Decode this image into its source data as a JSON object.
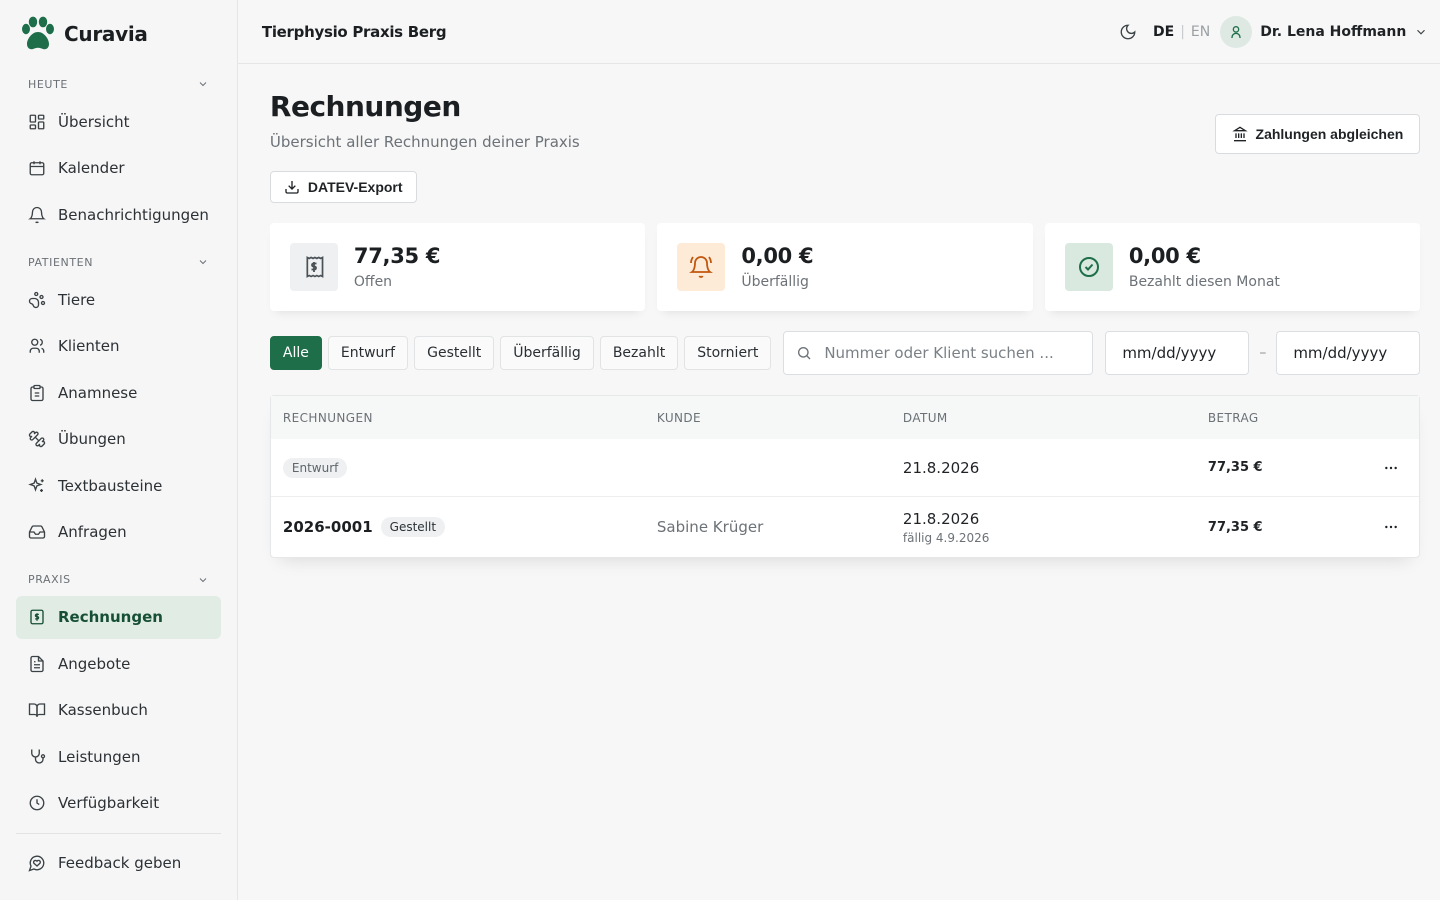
{
  "brand": {
    "name": "Curavia"
  },
  "sidebar": {
    "sections": [
      {
        "title": "HEUTE",
        "items": [
          {
            "label": "Übersicht",
            "icon": "layout-dashboard-icon"
          },
          {
            "label": "Kalender",
            "icon": "calendar-icon"
          },
          {
            "label": "Benachrichtigungen",
            "icon": "bell-icon"
          }
        ]
      },
      {
        "title": "PATIENTEN",
        "items": [
          {
            "label": "Tiere",
            "icon": "paw-icon"
          },
          {
            "label": "Klienten",
            "icon": "users-icon"
          },
          {
            "label": "Anamnese",
            "icon": "clipboard-icon"
          },
          {
            "label": "Übungen",
            "icon": "dumbbell-icon"
          },
          {
            "label": "Textbausteine",
            "icon": "sparkles-icon"
          },
          {
            "label": "Anfragen",
            "icon": "inbox-icon"
          }
        ]
      },
      {
        "title": "PRAXIS",
        "items": [
          {
            "label": "Rechnungen",
            "icon": "receipt-icon",
            "active": true
          },
          {
            "label": "Angebote",
            "icon": "file-text-icon"
          },
          {
            "label": "Kassenbuch",
            "icon": "book-open-icon"
          },
          {
            "label": "Leistungen",
            "icon": "stethoscope-icon"
          },
          {
            "label": "Verfügbarkeit",
            "icon": "clock-icon"
          }
        ]
      }
    ],
    "feedback": "Feedback geben"
  },
  "header": {
    "practice": "Tierphysio Praxis Berg",
    "lang_active": "DE",
    "lang_inactive": "EN",
    "user": "Dr. Lena Hoffmann"
  },
  "page": {
    "title": "Rechnungen",
    "subtitle": "Übersicht aller Rechnungen deiner Praxis",
    "sync_button": "Zahlungen abgleichen",
    "export_button": "DATEV-Export"
  },
  "stats": [
    {
      "value": "77,35 €",
      "label": "Offen",
      "icon": "receipt-icon",
      "bg": "#eef0f2",
      "fg": "#4b5257"
    },
    {
      "value": "0,00 €",
      "label": "Überfällig",
      "icon": "bell-ring-icon",
      "bg": "#fdebd8",
      "fg": "#c2570e"
    },
    {
      "value": "0,00 €",
      "label": "Bezahlt diesen Monat",
      "icon": "check-circle-icon",
      "bg": "#d9e9df",
      "fg": "#1e6f49"
    }
  ],
  "filters": {
    "chips": [
      "Alle",
      "Entwurf",
      "Gestellt",
      "Überfällig",
      "Bezahlt",
      "Storniert"
    ],
    "active": "Alle",
    "search_placeholder": "Nummer oder Klient suchen ...",
    "date_from": "mm/dd/yyyy",
    "date_to": "mm/dd/yyyy",
    "date_separator": "–"
  },
  "table": {
    "columns": [
      "RECHNUNGEN",
      "KUNDE",
      "DATUM",
      "BETRAG"
    ],
    "rows": [
      {
        "number": "",
        "status": "Entwurf",
        "customer": "",
        "date": "21.8.2026",
        "due": "",
        "amount": "77,35 €"
      },
      {
        "number": "2026-0001",
        "status": "Gestellt",
        "customer": "Sabine Krüger",
        "date": "21.8.2026",
        "due": "fällig 4.9.2026",
        "amount": "77,35 €"
      }
    ]
  },
  "colors": {
    "accent": "#1e6f49",
    "active_bg": "#e0ece4"
  }
}
